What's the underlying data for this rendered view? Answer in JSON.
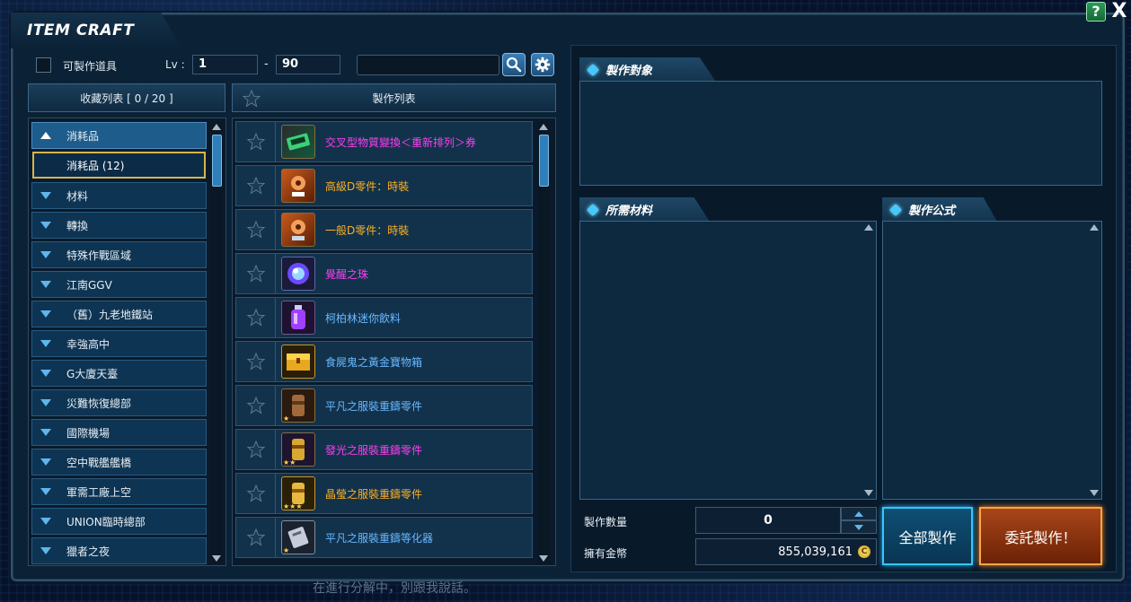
{
  "window": {
    "title": "ITEM CRAFT",
    "help_label": "?",
    "close_label": "X"
  },
  "filter": {
    "craftable_label": "可製作道具",
    "lv_label": "Lv :",
    "lv_min": "1",
    "lv_dash": "-",
    "lv_max": "90",
    "search_value": ""
  },
  "favorites": {
    "header": "收藏列表 [ 0 / 20 ]",
    "categories": [
      {
        "label": "消耗品",
        "expanded": true
      },
      {
        "label": "消耗品 (12)",
        "sub": true
      },
      {
        "label": "材料"
      },
      {
        "label": "轉換"
      },
      {
        "label": "特殊作戰區域"
      },
      {
        "label": "江南GGV"
      },
      {
        "label": "（舊）九老地鐵站"
      },
      {
        "label": "幸強高中"
      },
      {
        "label": "G大廈天臺"
      },
      {
        "label": "災難恢復總部"
      },
      {
        "label": "國際機場"
      },
      {
        "label": "空中戰艦艦橋"
      },
      {
        "label": "軍需工廠上空"
      },
      {
        "label": "UNION臨時總部"
      },
      {
        "label": "獵者之夜"
      }
    ]
  },
  "craft_list": {
    "header": "製作列表",
    "items": [
      {
        "name": "交叉型物質變換＜重新排列＞券",
        "color": "magenta",
        "icon": "ticket-icon",
        "stars": ""
      },
      {
        "name": "高級D零件：時裝",
        "color": "orange",
        "icon": "d-part-icon",
        "stars": ""
      },
      {
        "name": "一般D零件：時裝",
        "color": "orange",
        "icon": "d-part-icon",
        "stars": ""
      },
      {
        "name": "覺醒之珠",
        "color": "magenta",
        "icon": "orb-icon",
        "stars": ""
      },
      {
        "name": "柯柏林迷你飲料",
        "color": "blue",
        "icon": "potion-icon",
        "stars": ""
      },
      {
        "name": "食屍鬼之黃金寶物箱",
        "color": "blue",
        "icon": "treasure-box-icon",
        "stars": ""
      },
      {
        "name": "平凡之服裝重鑄零件",
        "color": "blue",
        "icon": "canister-icon",
        "stars": "★"
      },
      {
        "name": "發光之服裝重鑄零件",
        "color": "magenta",
        "icon": "canister-icon",
        "stars": "★★"
      },
      {
        "name": "晶瑩之服裝重鑄零件",
        "color": "orange",
        "icon": "canister-icon",
        "stars": "★★★"
      },
      {
        "name": "平凡之服裝重鑄等化器",
        "color": "blue",
        "icon": "equalizer-icon",
        "stars": "★"
      }
    ]
  },
  "right": {
    "target_title": "製作對象",
    "materials_title": "所需材料",
    "formula_title": "製作公式",
    "qty_label": "製作數量",
    "qty_value": "0",
    "money_label": "擁有金幣",
    "money_value": "855,039,161",
    "coin_glyph": "C",
    "craft_all_label": "全部製作",
    "commission_label": "委託製作！"
  },
  "chat_hint": "在進行分解中，別跟我說話。",
  "colors": {
    "magenta": "#ff3df0",
    "orange": "#ffb020",
    "blue": "#6ab8ff",
    "accent": "#34c8ff"
  }
}
